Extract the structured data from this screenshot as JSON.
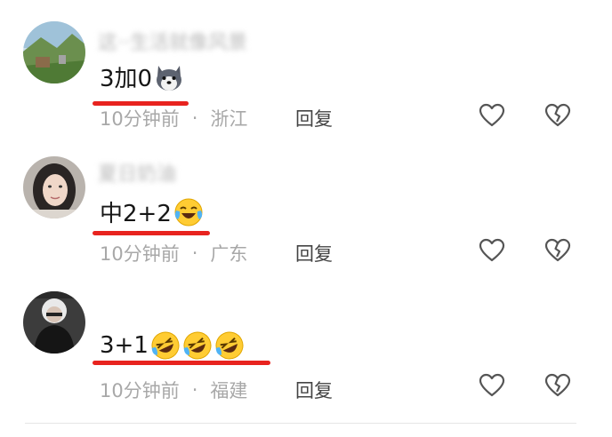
{
  "comments": [
    {
      "username": "这··生活就像风景",
      "text": "3加0",
      "emoji": "husky-emoji",
      "time": "10分钟前",
      "location": "浙江",
      "reply_label": "回复"
    },
    {
      "username": "夏日奶油",
      "text": "中2+2",
      "emoji": "laughing-crying-emoji",
      "time": "10分钟前",
      "location": "广东",
      "reply_label": "回复"
    },
    {
      "username": "",
      "text": "3+1",
      "emoji": "rolling-laughing-emoji",
      "time": "10分钟前",
      "location": "福建",
      "reply_label": "回复"
    }
  ],
  "separator": "·",
  "colors": {
    "underline": "#e8231f",
    "meta_text": "#a8a8a8",
    "icon_stroke": "#555555"
  }
}
